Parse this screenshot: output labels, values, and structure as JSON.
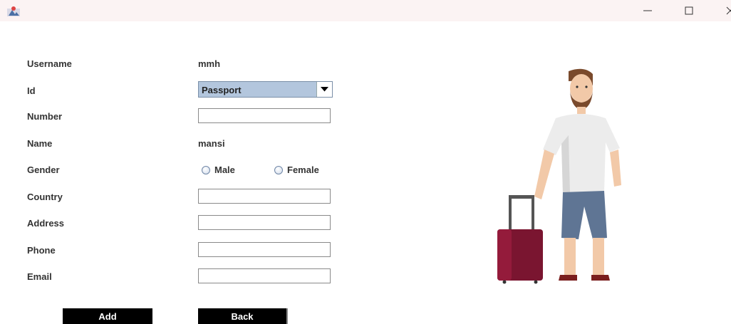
{
  "titlebar": {
    "icons": {
      "app": "java-app-icon",
      "minimize": "minimize-icon",
      "maximize": "maximize-icon",
      "close": "close-icon"
    }
  },
  "form": {
    "username_label": "Username",
    "username_value": "mmh",
    "id_label": "Id",
    "id_selected": "Passport",
    "number_label": "Number",
    "number_value": "",
    "name_label": "Name",
    "name_value": "mansi",
    "gender_label": "Gender",
    "gender_options": [
      "Male",
      "Female"
    ],
    "country_label": "Country",
    "country_value": "",
    "address_label": "Address",
    "address_value": "",
    "phone_label": "Phone",
    "phone_value": "",
    "email_label": "Email",
    "email_value": ""
  },
  "buttons": {
    "add": "Add",
    "back": "Back"
  },
  "illustration": {
    "icon": "traveler-with-suitcase-illustration"
  }
}
